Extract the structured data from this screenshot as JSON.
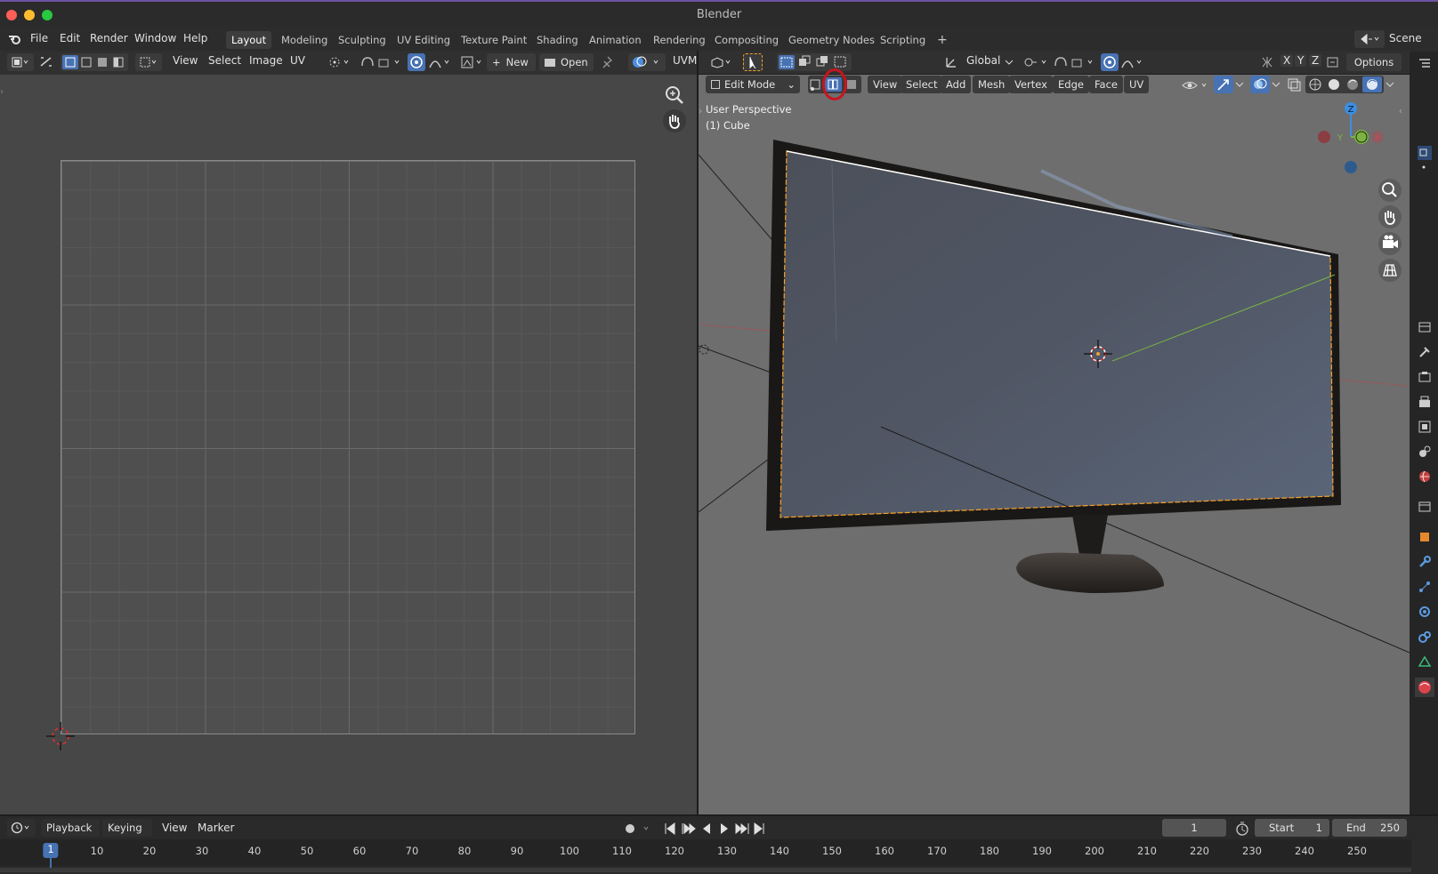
{
  "window": {
    "title": "Blender"
  },
  "menu": {
    "items": [
      "File",
      "Edit",
      "Render",
      "Window",
      "Help"
    ],
    "workspaces": [
      "Layout",
      "Modeling",
      "Sculpting",
      "UV Editing",
      "Texture Paint",
      "Shading",
      "Animation",
      "Rendering",
      "Compositing",
      "Geometry Nodes",
      "Scripting"
    ],
    "active_workspace": "Layout",
    "add_workspace": "+",
    "scene_label": "Scene"
  },
  "uv_editor": {
    "menus": [
      "View",
      "Select",
      "Image",
      "UV"
    ],
    "new_label": "New",
    "open_label": "Open",
    "uv_map_label": "UVM"
  },
  "viewport": {
    "transform_orientation": "Global",
    "axis_labels": [
      "X",
      "Y",
      "Z"
    ],
    "options_label": "Options",
    "mode": "Edit Mode",
    "menus": [
      "View",
      "Select",
      "Add",
      "Mesh",
      "Vertex",
      "Edge",
      "Face",
      "UV"
    ],
    "perspective_label": "User Perspective",
    "object_label": "(1) Cube",
    "gizmo": {
      "z": "Z",
      "y": "Y",
      "x": "X"
    },
    "colors": {
      "x_axis": "#d9434a",
      "y_axis": "#7cb342",
      "z_axis": "#3b8ee0",
      "selection": "#f6a12a",
      "highlight_ring": "#d01c1c"
    }
  },
  "timeline": {
    "menus": [
      "Playback",
      "Keying",
      "View",
      "Marker"
    ],
    "current_frame": "1",
    "start_label": "Start",
    "start_value": "1",
    "end_label": "End",
    "end_value": "250",
    "ruler_ticks": [
      "1",
      "10",
      "20",
      "30",
      "40",
      "50",
      "60",
      "70",
      "80",
      "90",
      "100",
      "110",
      "120",
      "130",
      "140",
      "150",
      "160",
      "170",
      "180",
      "190",
      "200",
      "210",
      "220",
      "230",
      "240",
      "250"
    ],
    "playhead_frame": "1"
  }
}
